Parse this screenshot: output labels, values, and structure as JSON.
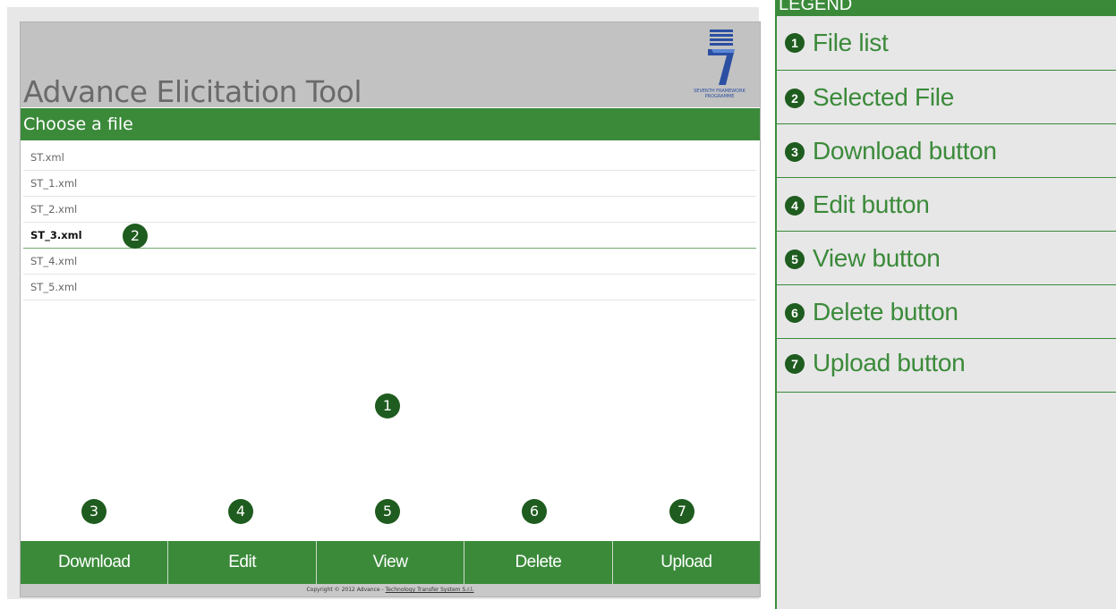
{
  "app": {
    "title": "Advance Elicitation Tool",
    "choose_label": "Choose a file",
    "logo_caption": "SEVENTH FRAMEWORK PROGRAMME",
    "files": [
      "ST.xml",
      "ST_1.xml",
      "ST_2.xml",
      "ST_3.xml",
      "ST_4.xml",
      "ST_5.xml"
    ],
    "selected_file": "ST_3.xml",
    "buttons": {
      "download": "Download",
      "edit": "Edit",
      "view": "View",
      "delete": "Delete",
      "upload": "Upload"
    },
    "footer": {
      "prefix": "Copyright © 2012 Advance - ",
      "link": "Technology Transfer System S.r.l."
    }
  },
  "markers": {
    "file_list": "1",
    "selected_file": "2",
    "download": "3",
    "edit": "4",
    "view": "5",
    "delete": "6",
    "upload": "7"
  },
  "legend": {
    "title": "LEGEND",
    "items": [
      {
        "num": "1",
        "label": "File list"
      },
      {
        "num": "2",
        "label": "Selected File"
      },
      {
        "num": "3",
        "label": "Download button"
      },
      {
        "num": "4",
        "label": "Edit button"
      },
      {
        "num": "5",
        "label": "View button"
      },
      {
        "num": "6",
        "label": "Delete button"
      },
      {
        "num": "7",
        "label": "Upload button"
      }
    ]
  },
  "colors": {
    "accent_green": "#3b8a3a",
    "marker_green": "#1f5c1f",
    "header_gray": "#c2c2c2"
  }
}
